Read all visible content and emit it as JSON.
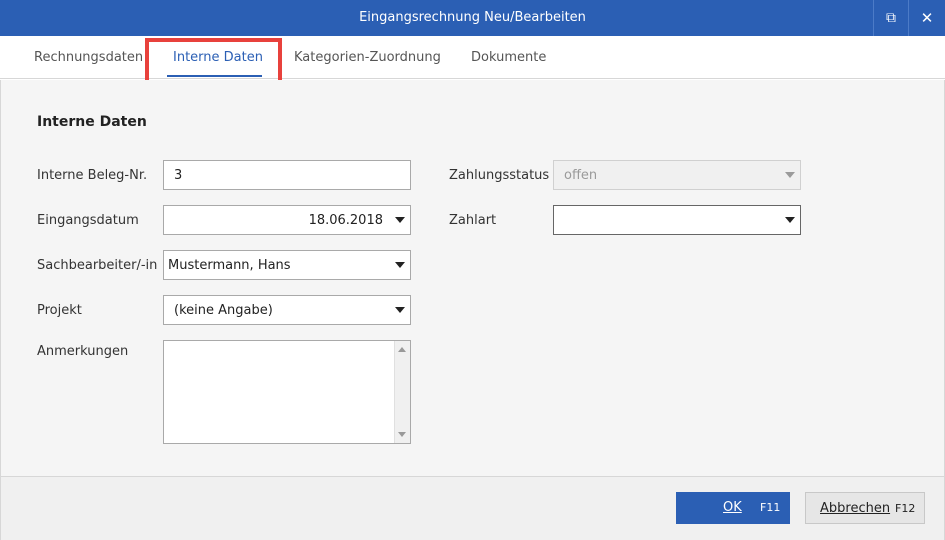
{
  "window": {
    "title": "Eingangsrechnung Neu/Bearbeiten",
    "popout_icon": "popout-icon",
    "close_icon": "close-icon",
    "popout_glyph": "⧉",
    "close_glyph": "✕"
  },
  "tabs": [
    {
      "label": "Rechnungsdaten",
      "active": false
    },
    {
      "label": "Interne Daten",
      "active": true
    },
    {
      "label": "Kategorien-Zuordnung",
      "active": false
    },
    {
      "label": "Dokumente",
      "active": false
    }
  ],
  "section": {
    "title": "Interne Daten"
  },
  "form": {
    "beleg_nr": {
      "label": "Interne Beleg-Nr.",
      "value": "3"
    },
    "eingangsdatum": {
      "label": "Eingangsdatum",
      "value": "18.06.2018"
    },
    "sachbearbeiter": {
      "label": "Sachbearbeiter/-in",
      "value": "Mustermann, Hans"
    },
    "projekt": {
      "label": "Projekt",
      "value": "(keine Angabe)"
    },
    "anmerkungen": {
      "label": "Anmerkungen",
      "value": ""
    },
    "zahlungsstatus": {
      "label": "Zahlungsstatus",
      "value": "offen"
    },
    "zahlart": {
      "label": "Zahlart",
      "value": ""
    }
  },
  "footer": {
    "ok": {
      "label": "OK",
      "key": "F11"
    },
    "cancel": {
      "label": "Abbrechen",
      "key": "F12"
    }
  },
  "colors": {
    "accent": "#2b5fb4",
    "highlight": "#e8413c"
  }
}
